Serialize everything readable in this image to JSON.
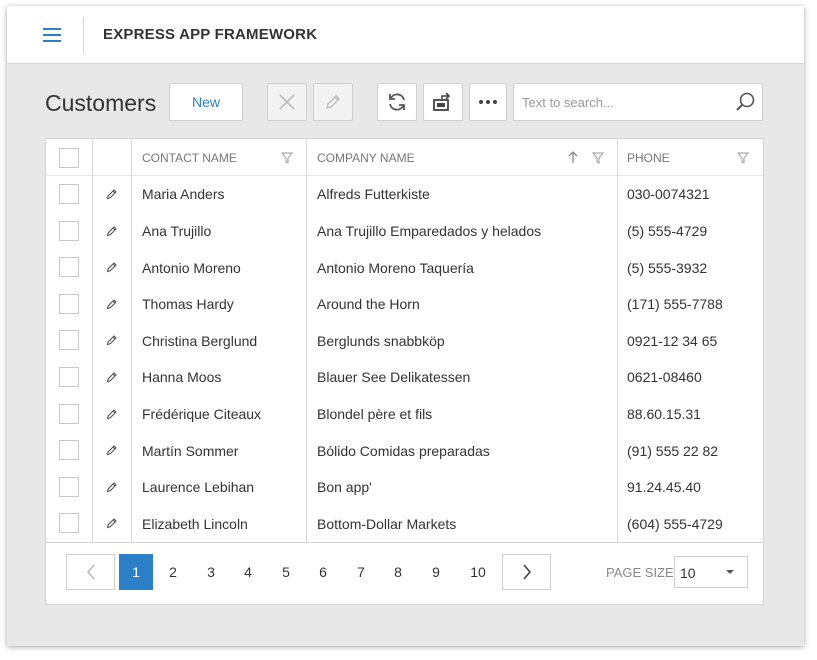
{
  "header": {
    "app_title": "EXPRESS APP FRAMEWORK"
  },
  "toolbar": {
    "title": "Customers",
    "new_label": "New",
    "search_placeholder": "Text to search..."
  },
  "grid": {
    "columns": {
      "contact": "CONTACT NAME",
      "company": "COMPANY NAME",
      "phone": "PHONE"
    },
    "rows": [
      {
        "contact": "Maria Anders",
        "company": "Alfreds Futterkiste",
        "phone": "030-0074321"
      },
      {
        "contact": "Ana Trujillo",
        "company": "Ana Trujillo Emparedados y helados",
        "phone": "(5) 555-4729"
      },
      {
        "contact": "Antonio Moreno",
        "company": "Antonio Moreno Taquería",
        "phone": "(5) 555-3932"
      },
      {
        "contact": "Thomas Hardy",
        "company": "Around the Horn",
        "phone": "(171) 555-7788"
      },
      {
        "contact": "Christina Berglund",
        "company": "Berglunds snabbköp",
        "phone": "0921-12 34 65"
      },
      {
        "contact": "Hanna Moos",
        "company": "Blauer See Delikatessen",
        "phone": "0621-08460"
      },
      {
        "contact": "Frédérique Citeaux",
        "company": "Blondel père et fils",
        "phone": "88.60.15.31"
      },
      {
        "contact": "Martín Sommer",
        "company": "Bólido Comidas preparadas",
        "phone": "(91) 555 22 82"
      },
      {
        "contact": "Laurence Lebihan",
        "company": "Bon app'",
        "phone": "91.24.45.40"
      },
      {
        "contact": "Elizabeth Lincoln",
        "company": "Bottom-Dollar Markets",
        "phone": "(604) 555-4729"
      }
    ]
  },
  "pager": {
    "pages": [
      "1",
      "2",
      "3",
      "4",
      "5",
      "6",
      "7",
      "8",
      "9",
      "10"
    ],
    "active_page": "1",
    "page_size_label": "PAGE SIZE",
    "page_size_value": "10"
  },
  "colors": {
    "accent": "#2b80c8",
    "border": "#cfcfcf",
    "background": "#e8e8e8"
  },
  "icons": [
    "menu-icon",
    "delete-icon",
    "edit-icon",
    "refresh-icon",
    "export-icon",
    "more-icon",
    "search-icon",
    "filter-icon",
    "sort-ascending-icon",
    "chevron-left-icon",
    "chevron-right-icon",
    "dropdown-caret-icon"
  ]
}
